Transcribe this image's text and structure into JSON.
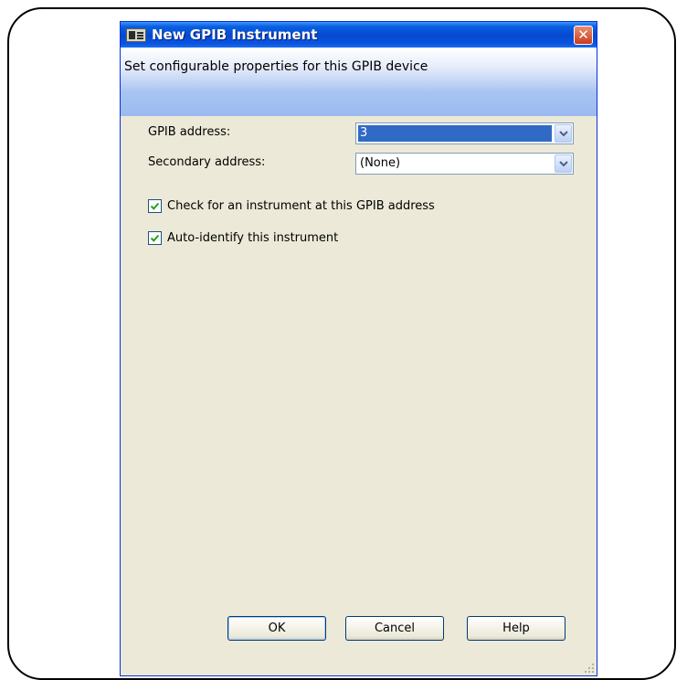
{
  "window": {
    "title": "New GPIB Instrument",
    "close_label": "✕",
    "subtitle": "Set configurable properties for this GPIB device",
    "colors": {
      "title_bar": "#0548d0",
      "body": "#ece9d8",
      "selection": "#316ac5",
      "close": "#cc3c1b"
    }
  },
  "form": {
    "gpib_address": {
      "label": "GPIB address:",
      "value": "3"
    },
    "secondary_address": {
      "label": "Secondary address:",
      "value": "(None)"
    },
    "check_instrument": {
      "label": "Check for an instrument at this GPIB address",
      "checked": true
    },
    "auto_identify": {
      "label": "Auto-identify this instrument",
      "checked": true
    }
  },
  "buttons": {
    "ok": "OK",
    "cancel": "Cancel",
    "help": "Help"
  }
}
